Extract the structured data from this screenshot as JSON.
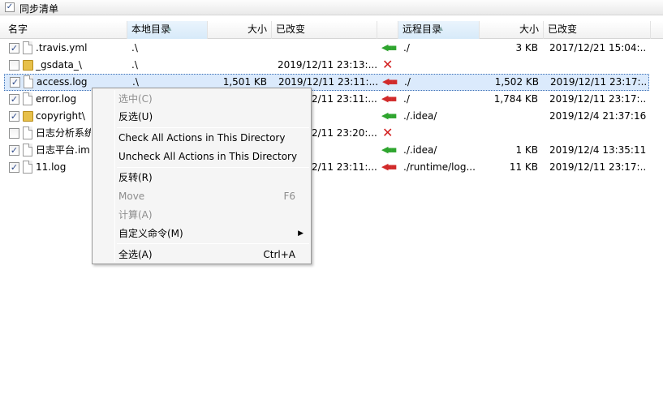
{
  "window": {
    "title": "同步清单"
  },
  "columns": {
    "name": "名字",
    "local_dir": "本地目录",
    "size": "大小",
    "changed": "已改变",
    "remote_dir": "远程目录",
    "remote_size": "大小",
    "remote_changed": "已改变"
  },
  "rows": [
    {
      "checked": "✓",
      "icon": "file",
      "name": ".travis.yml",
      "local_dir": ".\\",
      "size": "",
      "changed": "",
      "action": "download",
      "remote_dir": "./",
      "remote_size": "3 KB",
      "remote_changed": "2017/12/21 15:04:..."
    },
    {
      "checked": "",
      "icon": "folder",
      "name": "_gsdata_\\",
      "local_dir": ".\\",
      "size": "",
      "changed": "2019/12/11 23:13:...",
      "action": "delete",
      "remote_dir": "",
      "remote_size": "",
      "remote_changed": ""
    },
    {
      "checked": "✓",
      "icon": "file",
      "name": "access.log",
      "local_dir": ".\\",
      "size": "1,501 KB",
      "changed": "2019/12/11 23:11:...",
      "action": "upload",
      "remote_dir": "./",
      "remote_size": "1,502 KB",
      "remote_changed": "2019/12/11 23:17:..."
    },
    {
      "checked": "✓",
      "icon": "file",
      "name": "error.log",
      "local_dir": "",
      "size": "",
      "changed": "2/11 23:11:...",
      "action": "upload",
      "remote_dir": "./",
      "remote_size": "1,784 KB",
      "remote_changed": "2019/12/11 23:17:..."
    },
    {
      "checked": "✓",
      "icon": "folder",
      "name": "copyright\\",
      "local_dir": "",
      "size": "",
      "changed": "",
      "action": "download",
      "remote_dir": "./.idea/",
      "remote_size": "",
      "remote_changed": "2019/12/4 21:37:16"
    },
    {
      "checked": "",
      "icon": "file",
      "name": "日志分析系统",
      "local_dir": "",
      "size": "",
      "changed": "2/11 23:20:...",
      "action": "delete",
      "remote_dir": "",
      "remote_size": "",
      "remote_changed": ""
    },
    {
      "checked": "✓",
      "icon": "file",
      "name": "日志平台.iml",
      "local_dir": "",
      "size": "",
      "changed": "",
      "action": "download",
      "remote_dir": "./.idea/",
      "remote_size": "1 KB",
      "remote_changed": "2019/12/4 13:35:11"
    },
    {
      "checked": "✓",
      "icon": "file",
      "name": "11.log",
      "local_dir": "",
      "size": "",
      "changed": "2/11 23:11:...",
      "action": "upload",
      "remote_dir": "./runtime/log...",
      "remote_size": "11 KB",
      "remote_changed": "2019/12/11 23:17:..."
    }
  ],
  "context_menu": {
    "select": "选中(C)",
    "invert": "反选(U)",
    "check_all": "Check All Actions in This Directory",
    "uncheck_all": "Uncheck All Actions in This Directory",
    "reverse": "反转(R)",
    "move": "Move",
    "move_shortcut": "F6",
    "calculate": "计算(A)",
    "custom_command": "自定义命令(M)",
    "select_all": "全选(A)",
    "select_all_shortcut": "Ctrl+A"
  },
  "colors": {
    "selection": "#dbeafc",
    "upload_arrow": "#d12a2a",
    "download_arrow": "#2ea52e",
    "delete_mark": "#d21d1d"
  }
}
